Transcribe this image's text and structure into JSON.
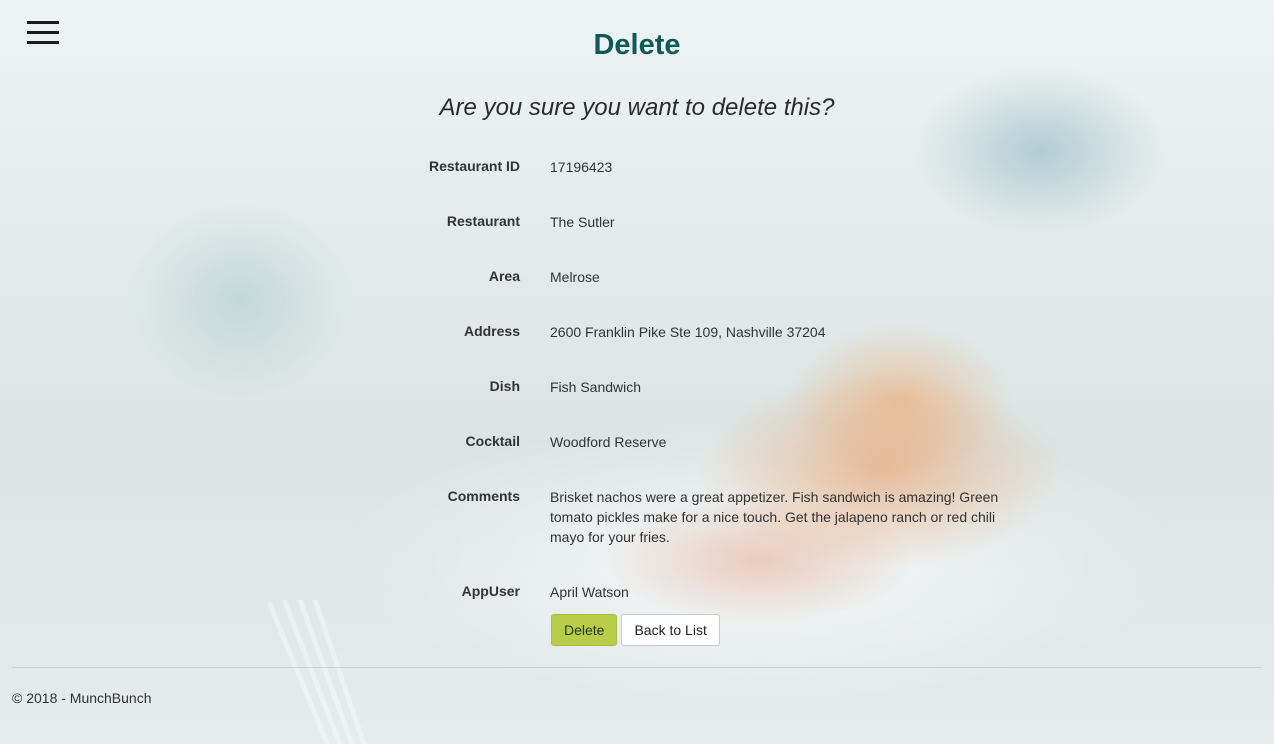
{
  "header": {
    "title": "Delete",
    "confirm_text": "Are you sure you want to delete this?"
  },
  "details": [
    {
      "label": "Restaurant ID",
      "value": "17196423"
    },
    {
      "label": "Restaurant",
      "value": "The Sutler"
    },
    {
      "label": "Area",
      "value": "Melrose"
    },
    {
      "label": "Address",
      "value": "2600 Franklin Pike Ste 109, Nashville 37204"
    },
    {
      "label": "Dish",
      "value": "Fish Sandwich"
    },
    {
      "label": "Cocktail",
      "value": "Woodford Reserve"
    },
    {
      "label": "Comments",
      "value": "Brisket nachos were a great appetizer. Fish sandwich is amazing! Green tomato pickles make for a nice touch. Get the jalapeno ranch or red chili mayo for your fries."
    },
    {
      "label": "AppUser",
      "value": "April Watson"
    }
  ],
  "actions": {
    "delete_label": "Delete",
    "back_label": "Back to List"
  },
  "footer": {
    "text": "© 2018 - MunchBunch"
  },
  "colors": {
    "title": "#0f5a57",
    "delete_button": "#b8cc4a"
  },
  "icons": {
    "menu": "hamburger-menu-icon"
  }
}
